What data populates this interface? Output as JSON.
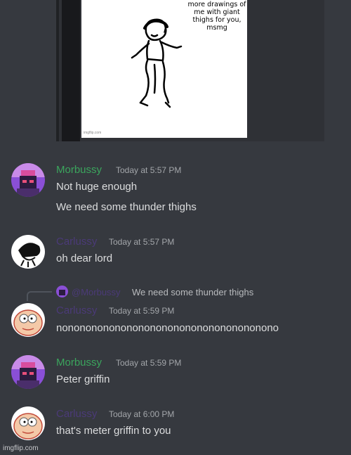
{
  "meme": {
    "caption": "more drawings of me with giant thighs for you, msmg",
    "source": "imgflip.com"
  },
  "messages": [
    {
      "author": "Morbussy",
      "time": "Today at 5:57 PM",
      "lines": [
        "Not huge enough",
        "We need some thunder thighs"
      ],
      "avatar": "morbius-avatar",
      "name_color": "#3ba55d"
    },
    {
      "author": "Carlussy",
      "time": "Today at 5:57 PM",
      "lines": [
        "oh dear lord"
      ],
      "avatar": "sunglasses-face-avatar",
      "name_color": "#4b3a78"
    },
    {
      "reply_to": {
        "mention": "@Morbussy",
        "text": "We need some thunder thighs"
      },
      "author": "Carlussy",
      "time": "Today at 5:59 PM",
      "lines": [
        "nonononononononononononononononononono"
      ],
      "avatar": "peter-griffin-avatar",
      "name_color": "#4b3a78"
    },
    {
      "author": "Morbussy",
      "time": "Today at 5:59 PM",
      "lines": [
        "Peter griffin"
      ],
      "avatar": "morbius-avatar",
      "name_color": "#3ba55d"
    },
    {
      "author": "Carlussy",
      "time": "Today at 6:00 PM",
      "lines": [
        "that's meter griffin to you"
      ],
      "avatar": "peter-griffin-avatar",
      "name_color": "#4b3a78"
    }
  ],
  "watermark": "imgflip.com"
}
